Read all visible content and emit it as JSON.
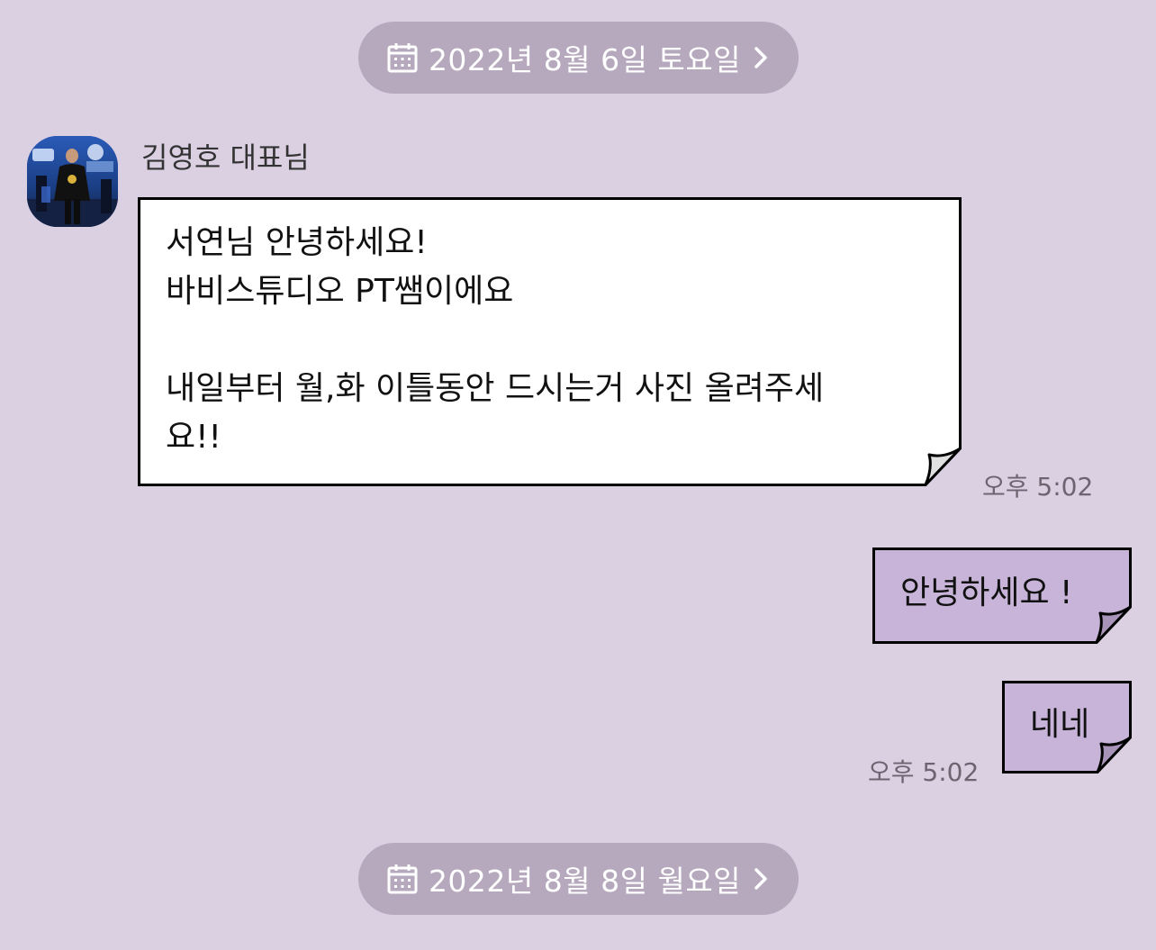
{
  "date_dividers": [
    {
      "label": "2022년 8월 6일 토요일"
    },
    {
      "label": "2022년 8월 8일 월요일"
    }
  ],
  "sender": {
    "name": "김영호 대표님"
  },
  "messages": [
    {
      "direction": "incoming",
      "text": "서연님 안녕하세요!\n바비스튜디오 PT쌤이에요\n\n내일부터 월,화 이틀동안 드시는거 사진 올려주세\n요!!",
      "time": "오후 5:02"
    },
    {
      "direction": "outgoing",
      "text": "안녕하세요 !"
    },
    {
      "direction": "outgoing",
      "text": "네네",
      "time": "오후 5:02"
    }
  ],
  "colors": {
    "background": "#dbcfe2",
    "date_pill": "#b6a9bd",
    "incoming_bubble": "#ffffff",
    "outgoing_bubble": "#c8b4d8",
    "fold": "#e0e0e0",
    "outgoing_fold": "#a994b9",
    "border": "#000000",
    "timestamp": "#6c6470"
  },
  "icons": {
    "date_calendar": "calendar-icon",
    "date_chevron": "chevron-right-icon"
  }
}
